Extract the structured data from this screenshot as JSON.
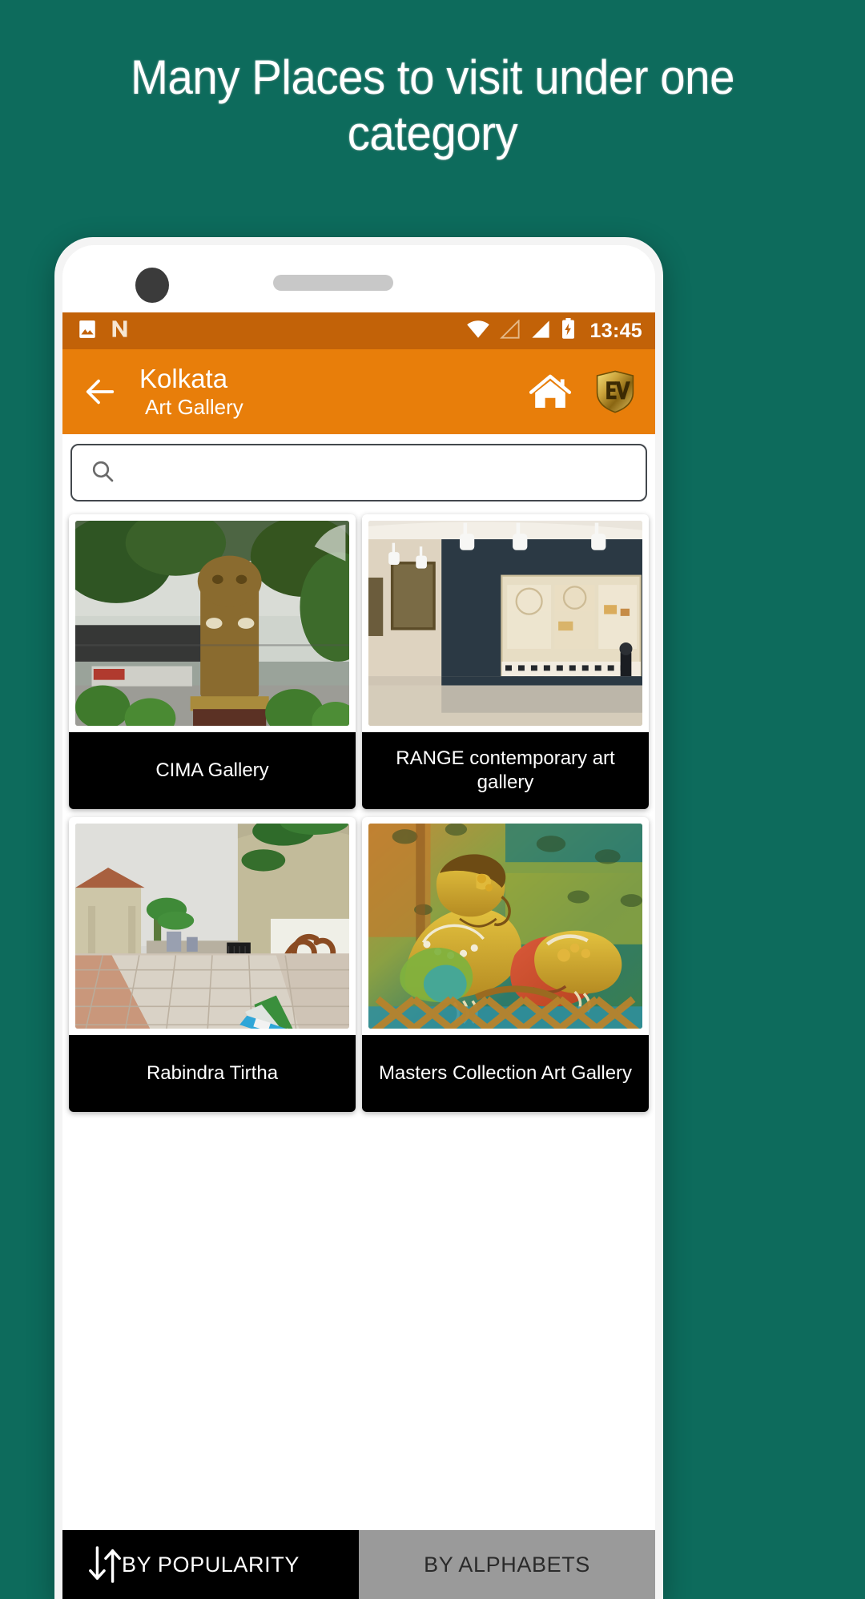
{
  "promo": {
    "heading": "Many Places to visit under one category"
  },
  "theme": {
    "background": "#0d6b5c",
    "status_bar": "#c26208",
    "toolbar": "#e87e0a",
    "card_label_bg": "#000000",
    "active_tab_bg": "#000000",
    "inactive_tab_bg": "#9a9a9a"
  },
  "phone": {
    "status_bar": {
      "icons_left": [
        "image-icon",
        "n-app-icon"
      ],
      "icons_right": [
        "wifi-icon",
        "signal-empty-icon",
        "signal-full-icon",
        "battery-charging-icon"
      ],
      "clock": "13:45"
    },
    "toolbar": {
      "back_label": "back-arrow",
      "title": "Kolkata",
      "subtitle": "Art Gallery",
      "home_label": "home-icon",
      "logo_label": "EV"
    },
    "search": {
      "value": "",
      "placeholder": "",
      "icon": "search-icon"
    },
    "cards": [
      {
        "title": "CIMA Gallery",
        "photo": "sculpture-in-garden"
      },
      {
        "title": "RANGE contemporary art gallery",
        "photo": "gallery-interior-painting"
      },
      {
        "title": "Rabindra Tirtha",
        "photo": "wet-paved-walkway"
      },
      {
        "title": "Masters Collection Art Gallery",
        "photo": "painting-two-figures"
      }
    ],
    "sort_bar": {
      "sort_icon": "sort-arrows-icon",
      "tabs": [
        {
          "label": "BY POPULARITY",
          "active": true
        },
        {
          "label": "BY ALPHABETS",
          "active": false
        }
      ]
    }
  }
}
